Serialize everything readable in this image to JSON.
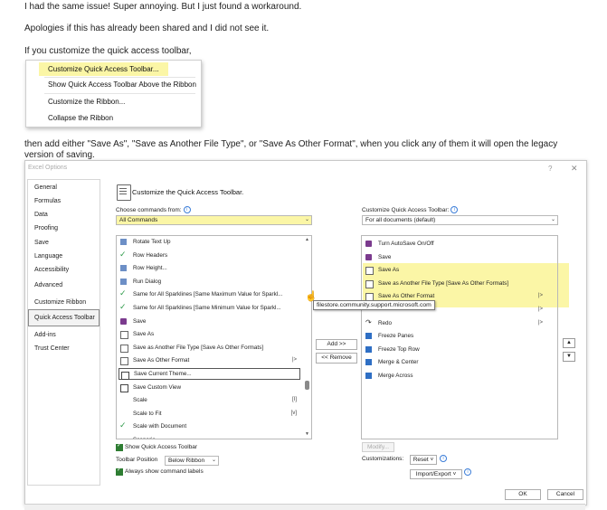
{
  "post": {
    "line1": "I had the same issue! Super annoying. But I just found a workaround.",
    "line2": "Apologies if this has already been shared and I did not see it.",
    "line3": "If you customize the quick access toolbar,",
    "line4": "then add either \"Save As\", \"Save as Another File Type\", or \"Save As Other Format\", when you click any of them it will open the legacy version of saving."
  },
  "context_menu": {
    "items": [
      "Customize Quick Access Toolbar...",
      "Show Quick Access Toolbar Above the Ribbon",
      "Customize the Ribbon...",
      "Collapse the Ribbon"
    ]
  },
  "dialog": {
    "title": "Excel Options",
    "help": "?",
    "close": "✕",
    "nav": [
      "General",
      "Formulas",
      "Data",
      "Proofing",
      "Save",
      "Language",
      "Accessibility",
      "Advanced",
      "Customize Ribbon",
      "Quick Access Toolbar",
      "Add-ins",
      "Trust Center"
    ],
    "selected_nav": "Quick Access Toolbar",
    "heading": "Customize the Quick Access Toolbar.",
    "choose_label": "Choose commands from:",
    "choose_value": "All Commands",
    "customize_label": "Customize Quick Access Toolbar:",
    "customize_value": "For all documents (default)",
    "left_list": [
      {
        "text": "Rotate Text Up",
        "icon": "text-rotate-icon"
      },
      {
        "text": "Row Headers",
        "icon": "check-icon"
      },
      {
        "text": "Row Height...",
        "icon": "row-height-icon"
      },
      {
        "text": "Run Dialog",
        "icon": "run-dialog-icon"
      },
      {
        "text": "Same for All Sparklines [Same Maximum Value for Sparkl...",
        "icon": "check-icon"
      },
      {
        "text": "Same for All Sparklines [Same Minimum Value for Sparkl...",
        "icon": "check-icon"
      },
      {
        "text": "Save",
        "icon": "save-icon"
      },
      {
        "text": "Save As",
        "icon": "save-as-icon"
      },
      {
        "text": "Save as Another File Type [Save As Other Formats]",
        "icon": "save-as-icon"
      },
      {
        "text": "Save As Other Format",
        "icon": "save-as-icon",
        "sub": "|>"
      },
      {
        "text": "Save Current Theme...",
        "icon": "theme-icon"
      },
      {
        "text": "Save Custom View",
        "icon": "custom-view-icon"
      },
      {
        "text": "Scale",
        "icon": "",
        "sub": "[I]"
      },
      {
        "text": "Scale to Fit",
        "icon": "",
        "sub": "[v]"
      },
      {
        "text": "Scale with Document",
        "icon": "check-icon"
      },
      {
        "text": "Scenario...",
        "icon": ""
      }
    ],
    "right_list": [
      {
        "text": "Turn AutoSave On/Off",
        "icon": "autosave-icon"
      },
      {
        "text": "Save",
        "icon": "save-icon"
      },
      {
        "text": "Save As",
        "icon": "save-as-icon"
      },
      {
        "text": "Save as Another File Type [Save As Other Formats]",
        "icon": "save-as-icon"
      },
      {
        "text": "Save As Other Format",
        "icon": "save-as-icon",
        "sub": "|>"
      },
      {
        "text": "",
        "icon": "",
        "sub": "|>"
      },
      {
        "text": "Redo",
        "icon": "redo-icon",
        "sub": "|>"
      },
      {
        "text": "Freeze Panes",
        "icon": "freeze-panes-icon"
      },
      {
        "text": "Freeze Top Row",
        "icon": "freeze-row-icon"
      },
      {
        "text": "Merge & Center",
        "icon": "merge-center-icon"
      },
      {
        "text": "Merge Across",
        "icon": "merge-across-icon"
      }
    ],
    "add_button": "Add >>",
    "remove_button": "<< Remove",
    "modify_button": "Modify...",
    "customizations_label": "Customizations:",
    "reset_button": "Reset ˅",
    "import_export_button": "Import/Export ˅",
    "show_qat_label": "Show Quick Access Toolbar",
    "toolbar_position_label": "Toolbar Position",
    "toolbar_position_value": "Below Ribbon",
    "always_show_labels": "Always show command labels",
    "ok_button": "OK",
    "cancel_button": "Cancel"
  },
  "tooltip": "filestore.community.support.microsoft.com",
  "colors": {
    "highlight": "#fbf6a6",
    "save_icon": "#7b3b8e",
    "check": "#2e9a4a"
  }
}
